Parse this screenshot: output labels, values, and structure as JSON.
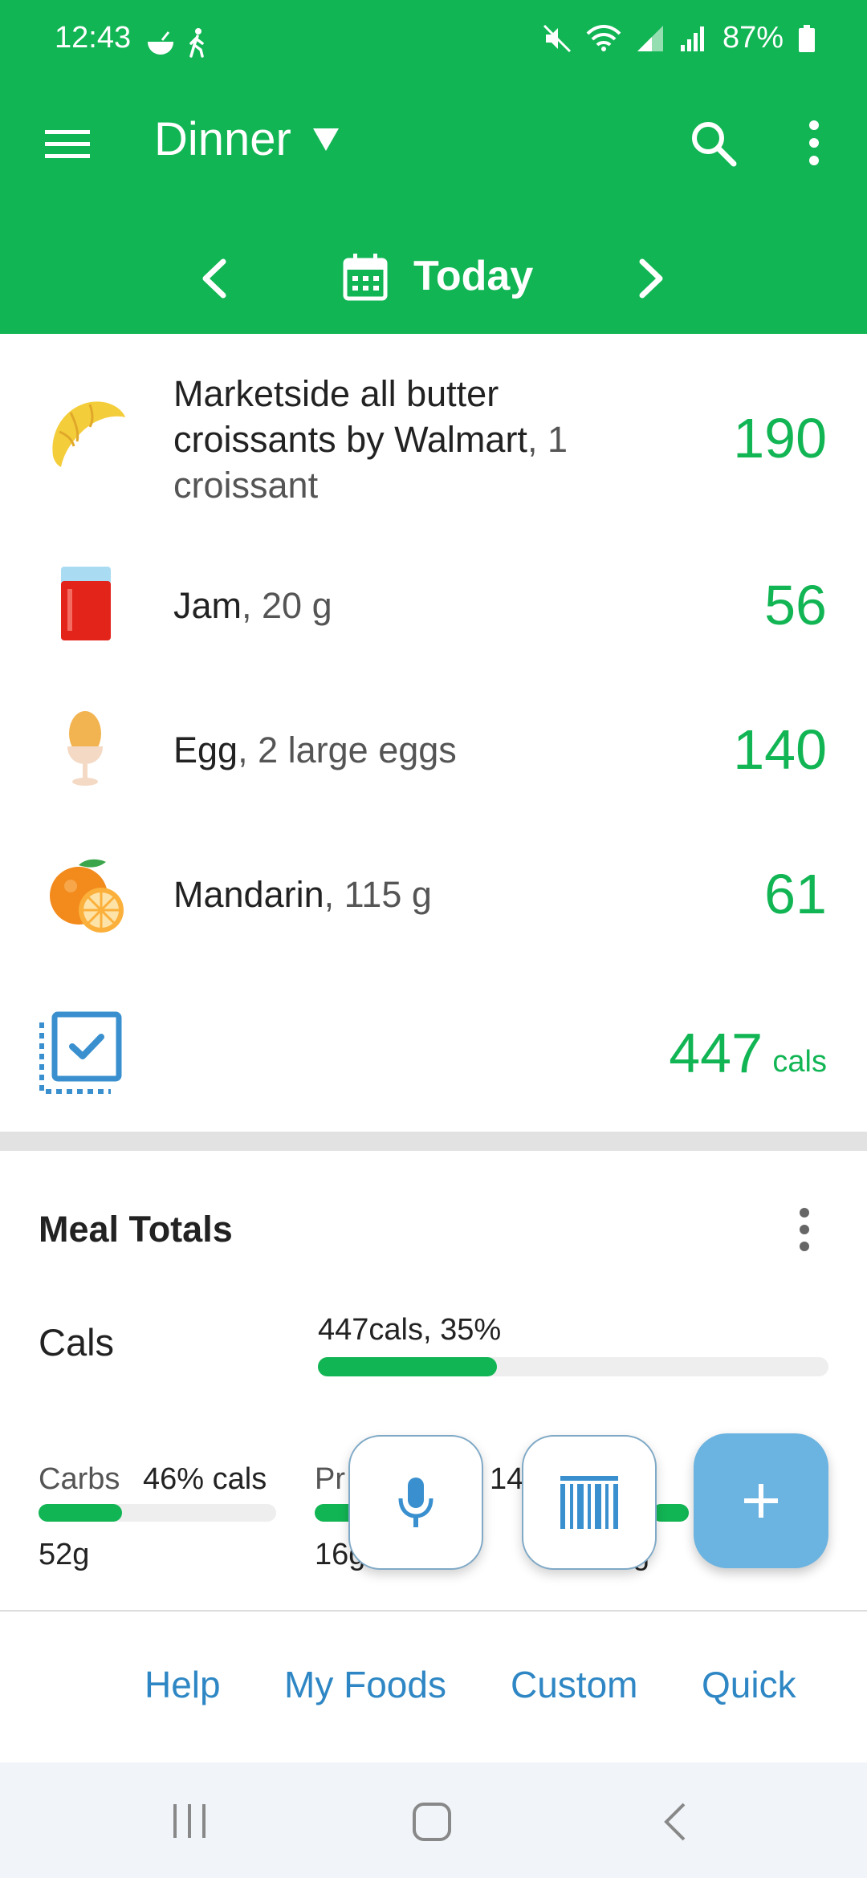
{
  "status_bar": {
    "time": "12:43",
    "battery": "87%"
  },
  "header": {
    "meal": "Dinner",
    "date": "Today",
    "background_color": "#12b554"
  },
  "foods": [
    {
      "name": "Marketside all butter croissants by Walmart",
      "amount": "1 croissant",
      "cals": "190",
      "icon": "croissant-icon"
    },
    {
      "name": "Jam",
      "amount": "20 g",
      "cals": "56",
      "icon": "jam-icon"
    },
    {
      "name": "Egg",
      "amount": "2 large eggs",
      "cals": "140",
      "icon": "egg-icon"
    },
    {
      "name": "Mandarin",
      "amount": "115 g",
      "cals": "61",
      "icon": "mandarin-icon"
    }
  ],
  "total": {
    "value": "447",
    "unit": "cals"
  },
  "meal_totals": {
    "title": "Meal Totals",
    "cals_label": "Cals",
    "cals_text": "447cals, 35%",
    "cals_pct": 35,
    "carbs_label": "Carbs",
    "carbs_pct_text": "46% cals",
    "carbs_value": "52g",
    "carbs_pct": 35,
    "protein_label_partial": "Pr",
    "protein_value_partial": "16g",
    "protein_pct_partial": "14",
    "fat_value_partial": "g"
  },
  "bottom_links": {
    "help": "Help",
    "my_foods": "My Foods",
    "custom": "Custom",
    "quick": "Quick"
  },
  "accent_color": "#12b554",
  "link_color": "#2e87c4"
}
